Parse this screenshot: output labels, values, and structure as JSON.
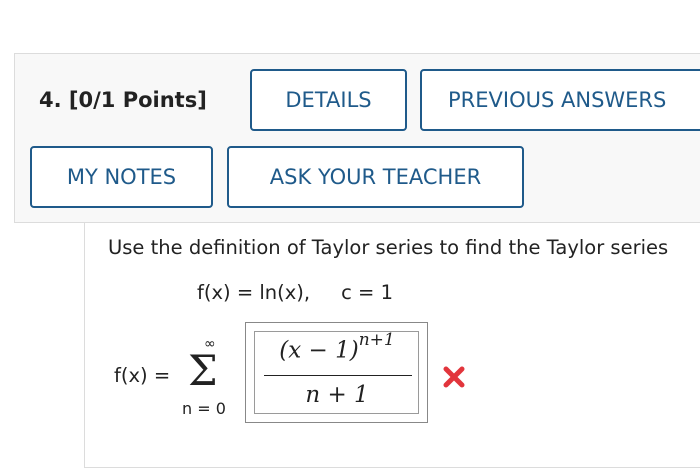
{
  "question": {
    "number": "4.",
    "points": "[0/1 Points]"
  },
  "buttons": {
    "details": "DETAILS",
    "previous_answers": "PREVIOUS ANSWERS",
    "my_notes": "MY NOTES",
    "ask_teacher": "ASK YOUR TEACHER"
  },
  "problem": {
    "instruction": "Use the definition of Taylor series to find the Taylor series",
    "function_lhs": "f(x)",
    "function_rhs": "ln(x),",
    "center": "c = 1"
  },
  "answer": {
    "lhs": "f(x) =",
    "sum_upper": "∞",
    "sum_symbol": "Σ",
    "sum_lower": "n = 0",
    "numerator_base": "(x − 1)",
    "numerator_exponent": "n+1",
    "denominator": "n + 1",
    "status": "incorrect",
    "status_icon": "x-mark-icon",
    "status_color": "#e2353c"
  },
  "colors": {
    "button_accent": "#1f5a8a",
    "panel_background": "#f8f8f8"
  }
}
